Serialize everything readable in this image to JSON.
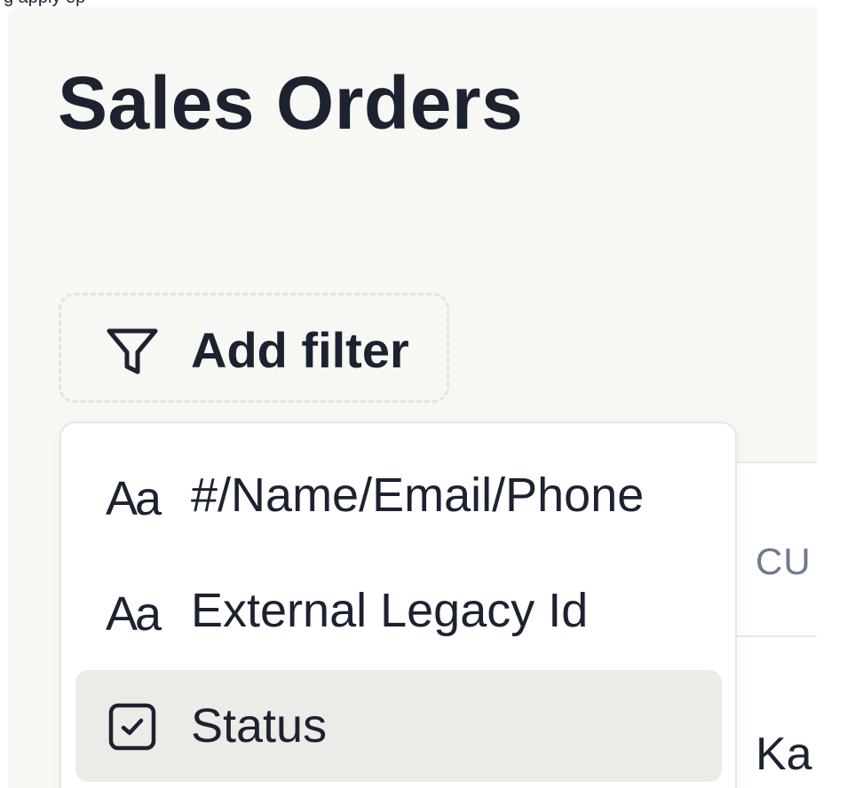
{
  "page": {
    "title": "Sales Orders",
    "background_color": "#f7f7f3"
  },
  "top_strip": {
    "text": "g   apply    ep"
  },
  "filter": {
    "add_label": "Add filter",
    "icon": "funnel-icon"
  },
  "dropdown": {
    "options": [
      {
        "label": "#/Name/Email/Phone",
        "icon": "text-type-icon",
        "icon_text": "Aa",
        "selected": false
      },
      {
        "label": "External Legacy Id",
        "icon": "text-type-icon",
        "icon_text": "Aa",
        "selected": false
      },
      {
        "label": "Status",
        "icon": "checkbox-icon",
        "selected": true
      }
    ]
  },
  "table": {
    "header_partial": "CU",
    "cell_partial": "Ka"
  },
  "colors": {
    "text_primary": "#1c2230",
    "header_text": "#6d7a90",
    "selected_bg": "#ebebe8"
  }
}
